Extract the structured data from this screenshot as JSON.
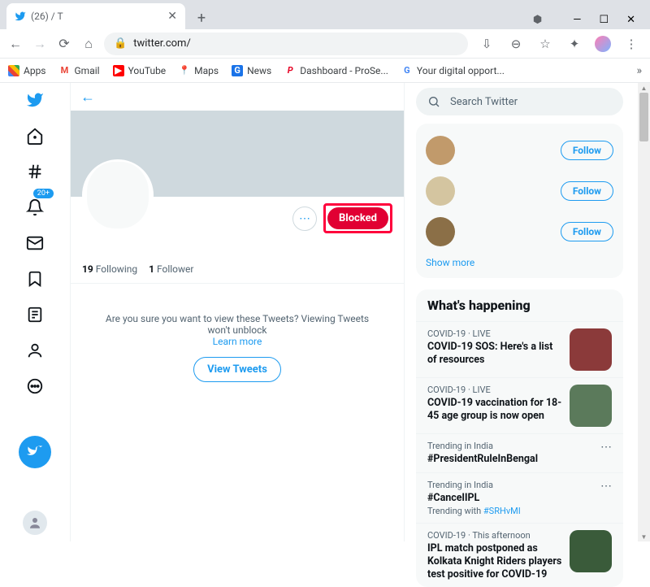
{
  "browser": {
    "tab_title": "(26)                              / T",
    "url": "twitter.com/",
    "bookmarks": [
      {
        "label": "Apps",
        "icon": "grid",
        "color": ""
      },
      {
        "label": "Gmail",
        "icon": "M",
        "color": "#ea4335"
      },
      {
        "label": "YouTube",
        "icon": "▶",
        "color": "#ff0000"
      },
      {
        "label": "Maps",
        "icon": "📍",
        "color": ""
      },
      {
        "label": "News",
        "icon": "G",
        "color": "#1a73e8"
      },
      {
        "label": "Dashboard - ProSe...",
        "icon": "P",
        "color": "#e60023"
      },
      {
        "label": "Your digital opport...",
        "icon": "G",
        "color": ""
      }
    ]
  },
  "leftnav": {
    "badge": "20+"
  },
  "profile": {
    "blocked_label": "Blocked",
    "following_count": "19",
    "following_label": "Following",
    "follower_count": "1",
    "follower_label": "Follower",
    "blocked_msg": "Are you sure you want to view these Tweets? Viewing Tweets won't unblock",
    "learn_more": "Learn more",
    "view_tweets": "View Tweets"
  },
  "right": {
    "search_placeholder": "Search Twitter",
    "follow_label": "Follow",
    "show_more": "Show more",
    "whats_heading": "What's happening",
    "trends": [
      {
        "meta": "COVID-19 · LIVE",
        "title": "COVID-19 SOS: Here's a list of resources",
        "has_img": true
      },
      {
        "meta": "COVID-19 · LIVE",
        "title": "COVID-19 vaccination for 18-45 age group is now open",
        "has_img": true
      },
      {
        "meta": "Trending in India",
        "title": "#PresidentRuleInBengal",
        "has_more": true
      },
      {
        "meta": "Trending in India",
        "title": "#CancelIPL",
        "sub_prefix": "Trending with ",
        "sub_link": "#SRHvMI",
        "has_more": true
      },
      {
        "meta": "COVID-19 · This afternoon",
        "title": "IPL match postponed as Kolkata Knight Riders players test positive for COVID-19",
        "has_img": true
      }
    ]
  }
}
